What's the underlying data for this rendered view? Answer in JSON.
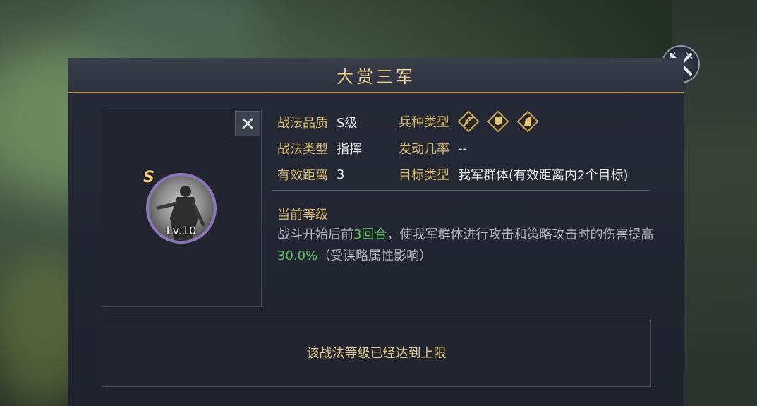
{
  "dialog": {
    "title": "大赏三军"
  },
  "skill": {
    "grade_badge": "S",
    "level": "Lv.10"
  },
  "info": {
    "quality_label": "战法品质",
    "quality_value": "S级",
    "troop_type_label": "兵种类型",
    "troop_type_icons": [
      "bow-cavalry-icon",
      "shield-infantry-icon",
      "horse-cavalry-icon"
    ],
    "category_label": "战法类型",
    "category_value": "指挥",
    "trigger_rate_label": "发动几率",
    "trigger_rate_value": "--",
    "range_label": "有效距离",
    "range_value": "3",
    "target_label": "目标类型",
    "target_value": "我军群体(有效距离内2个目标)"
  },
  "current_level": {
    "title": "当前等级",
    "desc_part1": "战斗开始后前",
    "desc_rounds": "3回合",
    "desc_part2": "，使我军群体进行攻击和策略攻击时的伤害提高",
    "desc_percent": "30.0%",
    "desc_part3": "（受谋略属性影响）"
  },
  "footer": {
    "max_level_note": "该战法等级已经达到上限"
  },
  "colors": {
    "gold": "#d9b971",
    "highlight_green": "#5fbf5f",
    "frame_purple": "#8b76b8"
  }
}
